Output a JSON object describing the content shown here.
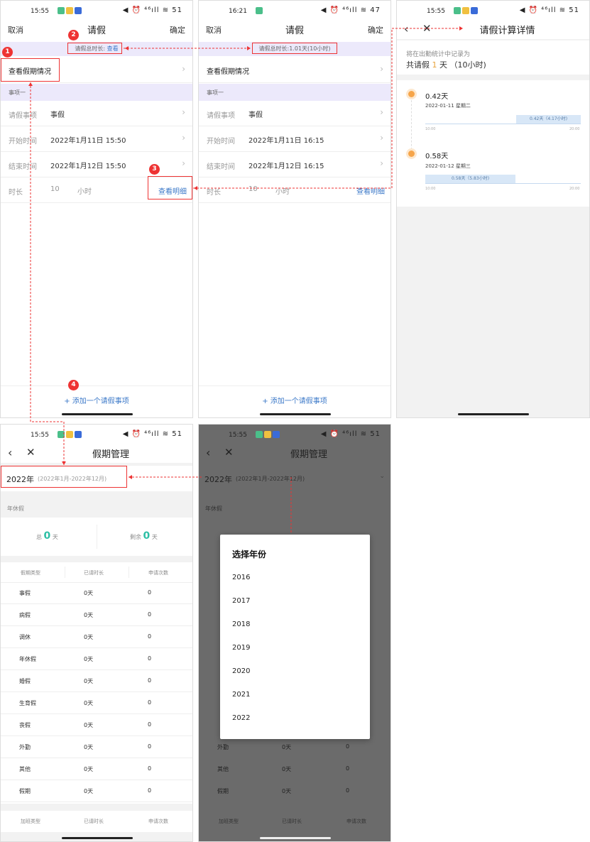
{
  "status": {
    "time1": "15:55",
    "time2": "16:21",
    "time3": "15:55",
    "time4": "15:55",
    "time5": "15:55",
    "right1": "◀ ⏰ ⁴⁶ıll ≋ 51",
    "right2": "◀ ⏰ ⁴⁶ıll ≋ 47",
    "right3": "◀ ⏰ ⁴⁶ıll ≋ 51",
    "right4": "◀ ⏰ ⁴⁶ıll ≋ 51",
    "right5": "◀ ⏰ ⁴⁶ıll ≋ 51"
  },
  "leave_form": {
    "cancel": "取消",
    "title": "请假",
    "confirm": "确定",
    "notice_label": "请假总时长:",
    "notice_link": "查看",
    "view_status": "查看假期情况",
    "section": "事项一",
    "type_label": "请假事项",
    "type_value": "事假",
    "start_label": "开始时间",
    "start_value": "2022年1月11日 15:50",
    "end_label": "结束时间",
    "end_value": "2022年1月12日 15:50",
    "duration_label": "时长",
    "duration_value": "10",
    "duration_unit": "小时",
    "detail_link": "查看明细",
    "add_item": "+ 添加一个请假事项"
  },
  "leave_form2": {
    "notice": "请假总时长:1.01天(10小时)",
    "start_value": "2022年1月11日 16:15",
    "end_value": "2022年1月12日 16:15"
  },
  "detail": {
    "title": "请假计算详情",
    "subtitle": "将在出勤统计中记录为",
    "total_prefix": "共请假",
    "total_num": "1",
    "total_suffix": "天 （10小时)",
    "day1": "0.42天",
    "date1": "2022-01-11 星期二",
    "bar1": "0.42天（4.17小时)",
    "day2": "0.58天",
    "date2": "2022-01-12 星期三",
    "bar2": "0.58天（5.83小时)",
    "tick_start": "10:00",
    "tick_end": "20:00"
  },
  "holiday": {
    "title": "假期管理",
    "year": "2022年",
    "range": "(2022年1月-2022年12月)",
    "annual_section": "年休假",
    "total_label": "总",
    "total_value": "0",
    "total_unit": "天",
    "remain_label": "剩余",
    "remain_value": "0",
    "remain_unit": "天",
    "headers": [
      "假期类型",
      "已请时长",
      "申请次数"
    ],
    "rows": [
      [
        "事假",
        "0天",
        "0"
      ],
      [
        "病假",
        "0天",
        "0"
      ],
      [
        "调休",
        "0天",
        "0"
      ],
      [
        "年休假",
        "0天",
        "0"
      ],
      [
        "婚假",
        "0天",
        "0"
      ],
      [
        "生育假",
        "0天",
        "0"
      ],
      [
        "丧假",
        "0天",
        "0"
      ],
      [
        "外勤",
        "0天",
        "0"
      ],
      [
        "其他",
        "0天",
        "0"
      ],
      [
        "假期",
        "0天",
        "0"
      ]
    ],
    "headers2": [
      "加班类型",
      "已请时长",
      "申请次数"
    ]
  },
  "year_picker": {
    "title": "选择年份",
    "options": [
      "2016",
      "2017",
      "2018",
      "2019",
      "2020",
      "2021",
      "2022"
    ]
  },
  "annotations": [
    "1",
    "2",
    "3",
    "4"
  ],
  "colors": {
    "accent": "#3b78c8",
    "annotation": "#e33333",
    "highlight": "#2dbfa5"
  }
}
